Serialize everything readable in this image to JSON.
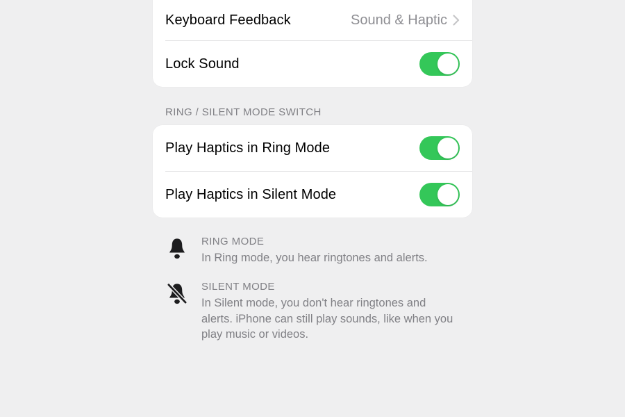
{
  "group1": {
    "keyboard_feedback": {
      "label": "Keyboard Feedback",
      "value": "Sound & Haptic"
    },
    "lock_sound": {
      "label": "Lock Sound",
      "on": true
    }
  },
  "section_header": "RING / SILENT MODE SWITCH",
  "group2": {
    "ring_haptics": {
      "label": "Play Haptics in Ring Mode",
      "on": true
    },
    "silent_haptics": {
      "label": "Play Haptics in Silent Mode",
      "on": true
    }
  },
  "footer": {
    "ring": {
      "title": "RING MODE",
      "desc": "In Ring mode, you hear ringtones and alerts."
    },
    "silent": {
      "title": "SILENT MODE",
      "desc": "In Silent mode, you don't hear ringtones and alerts. iPhone can still play sounds, like when you play music or videos."
    }
  },
  "colors": {
    "toggle_on": "#34c759",
    "background": "#efeff0"
  }
}
